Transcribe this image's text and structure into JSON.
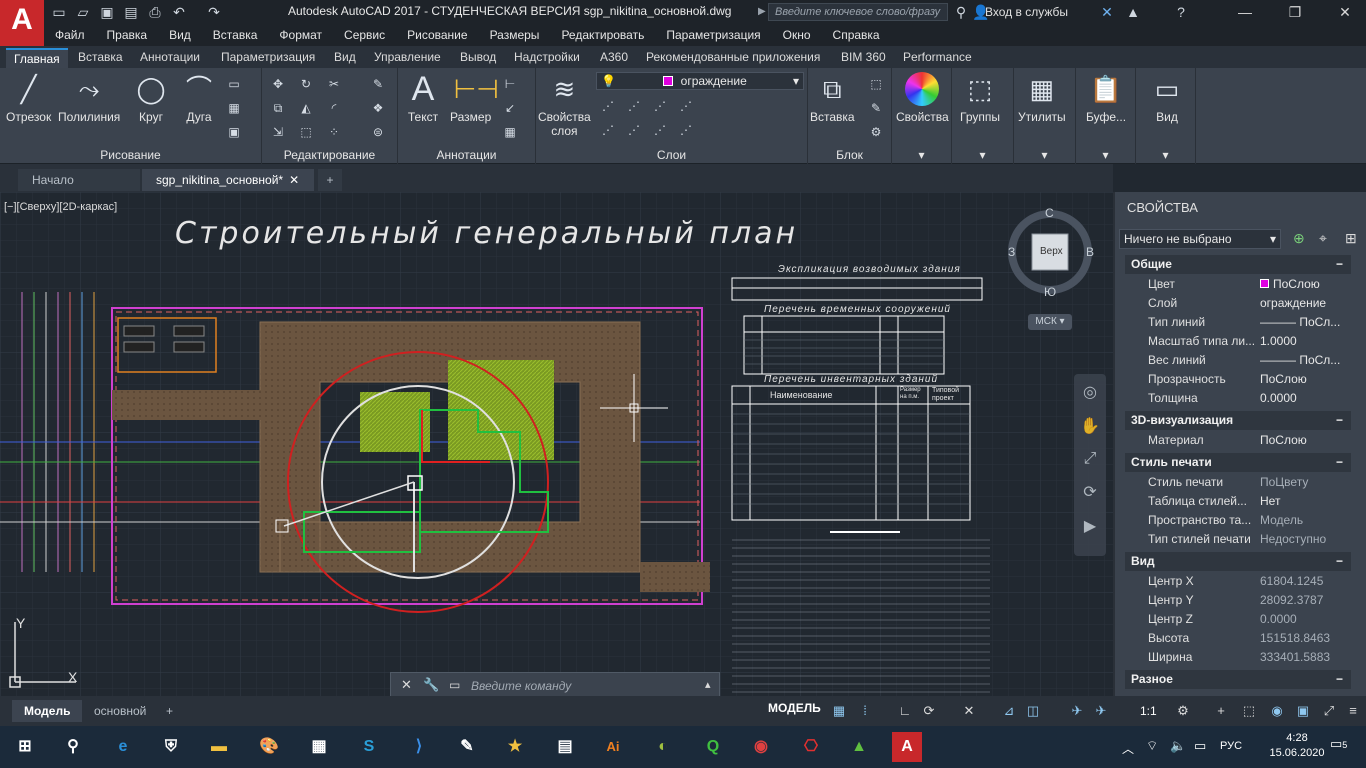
{
  "window": {
    "title": "Autodesk AutoCAD 2017 - СТУДЕНЧЕСКАЯ ВЕРСИЯ     sgp_nikitina_основной.dwg",
    "search_placeholder": "Введите ключевое слово/фразу",
    "signin": "Вход в службы"
  },
  "menu": [
    "Файл",
    "Правка",
    "Вид",
    "Вставка",
    "Формат",
    "Сервис",
    "Рисование",
    "Размеры",
    "Редактировать",
    "Параметризация",
    "Окно",
    "Справка"
  ],
  "ribbon_tabs": [
    "Главная",
    "Вставка",
    "Аннотации",
    "Параметризация",
    "Вид",
    "Управление",
    "Вывод",
    "Надстройки",
    "A360",
    "Рекомендованные приложения",
    "BIM 360",
    "Performance"
  ],
  "ribbon": {
    "draw": {
      "title": "Рисование",
      "line": "Отрезок",
      "polyline": "Полилиния",
      "circle": "Круг",
      "arc": "Дуга"
    },
    "modify": {
      "title": "Редактирование"
    },
    "annotation": {
      "title": "Аннотации",
      "text": "Текст",
      "dimension": "Размер"
    },
    "layers": {
      "title": "Слои",
      "properties": "Свойства слоя",
      "current_layer": "ограждение",
      "layer_color": "#e000e0"
    },
    "block": {
      "title": "Блок",
      "insert": "Вставка"
    },
    "properties": "Свойства",
    "groups": "Группы",
    "utilities": "Утилиты",
    "clipboard": "Буфе...",
    "view": "Вид"
  },
  "file_tabs": [
    "Начало",
    "sgp_nikitina_основной*"
  ],
  "viewport": {
    "label": "[−][Сверху][2D-каркас]",
    "drawing_title": "Строительный генеральный план",
    "viewcube": {
      "top": "Верх",
      "n": "С",
      "s": "Ю",
      "w": "З",
      "e": "В",
      "ucs": "МСК"
    },
    "table1_title": "Экспликация возводимых здания",
    "table2_title": "Перечень временных сооружений",
    "table3_title": "Перечень инвентарных зданий",
    "table3_head": [
      "Наименование",
      "Размер на п.м.",
      "Типовой проект"
    ]
  },
  "command_placeholder": "Введите команду",
  "properties_palette": {
    "title": "СВОЙСТВА",
    "selection": "Ничего не выбрано",
    "sections": [
      {
        "name": "Общие",
        "rows": [
          {
            "k": "Цвет",
            "v": "ПоСлою"
          },
          {
            "k": "Слой",
            "v": "ограждение"
          },
          {
            "k": "Тип линий",
            "v": "——— ПоСл..."
          },
          {
            "k": "Масштаб типа ли...",
            "v": "1.0000"
          },
          {
            "k": "Вес линий",
            "v": "——— ПоСл..."
          },
          {
            "k": "Прозрачность",
            "v": "ПоСлою"
          },
          {
            "k": "Толщина",
            "v": "0.0000"
          }
        ]
      },
      {
        "name": "3D-визуализация",
        "rows": [
          {
            "k": "Материал",
            "v": "ПоСлою"
          }
        ]
      },
      {
        "name": "Стиль печати",
        "rows": [
          {
            "k": "Стиль печати",
            "v": "ПоЦвету"
          },
          {
            "k": "Таблица стилей...",
            "v": "Нет"
          },
          {
            "k": "Пространство та...",
            "v": "Модель"
          },
          {
            "k": "Тип стилей печати",
            "v": "Недоступно"
          }
        ]
      },
      {
        "name": "Вид",
        "rows": [
          {
            "k": "Центр X",
            "v": "61804.1245"
          },
          {
            "k": "Центр Y",
            "v": "28092.3787"
          },
          {
            "k": "Центр Z",
            "v": "0.0000"
          },
          {
            "k": "Высота",
            "v": "151518.8463"
          },
          {
            "k": "Ширина",
            "v": "333401.5883"
          }
        ]
      },
      {
        "name": "Разное",
        "rows": []
      }
    ]
  },
  "layout_tabs": [
    "Модель",
    "основной"
  ],
  "status": {
    "model": "МОДЕЛЬ",
    "scale": "1:1"
  },
  "taskbar": {
    "lang": "РУС",
    "time": "4:28",
    "date": "15.06.2020",
    "notifications": "5"
  }
}
